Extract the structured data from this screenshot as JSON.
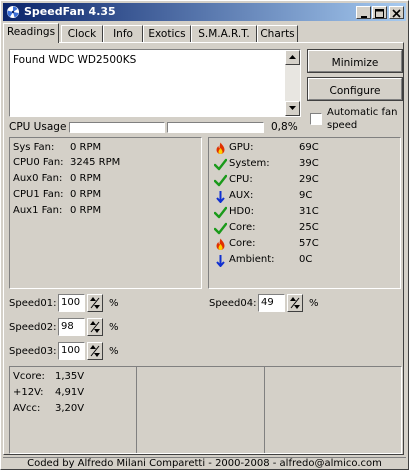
{
  "window": {
    "title": "SpeedFan 4.35",
    "controls": [
      "_",
      "□",
      "×"
    ]
  },
  "tabs": [
    "Readings",
    "Clock",
    "Info",
    "Exotics",
    "S.M.A.R.T.",
    "Charts"
  ],
  "active_tab": "Readings",
  "log": {
    "text": "Found WDC WD2500KS"
  },
  "buttons": {
    "minimize": "Minimize",
    "configure": "Configure"
  },
  "auto_fan": {
    "label_line1": "Automatic fan",
    "label_line2": "speed",
    "checked": false
  },
  "cpu_usage": {
    "label": "CPU Usage",
    "value": "0,8%",
    "bar1_fraction": 0.0,
    "bar2_fraction": 0.0
  },
  "fans": [
    {
      "label": "Sys Fan:",
      "value": "0 RPM"
    },
    {
      "label": "CPU0 Fan:",
      "value": "3245 RPM"
    },
    {
      "label": "Aux0 Fan:",
      "value": "0 RPM"
    },
    {
      "label": "CPU1 Fan:",
      "value": "0 RPM"
    },
    {
      "label": "Aux1 Fan:",
      "value": "0 RPM"
    }
  ],
  "temps": [
    {
      "label": "GPU:",
      "value": "69C",
      "icon": "flame-icon"
    },
    {
      "label": "System:",
      "value": "39C",
      "icon": "checkmark-icon"
    },
    {
      "label": "CPU:",
      "value": "29C",
      "icon": "checkmark-icon"
    },
    {
      "label": "AUX:",
      "value": "9C",
      "icon": "down-arrow-icon"
    },
    {
      "label": "HD0:",
      "value": "31C",
      "icon": "checkmark-icon"
    },
    {
      "label": "Core:",
      "value": "25C",
      "icon": "checkmark-icon"
    },
    {
      "label": "Core:",
      "value": "57C",
      "icon": "flame-icon"
    },
    {
      "label": "Ambient:",
      "value": "0C",
      "icon": "down-arrow-icon"
    }
  ],
  "speeds": [
    {
      "label": "Speed01:",
      "value": "100",
      "unit": "%"
    },
    {
      "label": "Speed02:",
      "value": "98",
      "unit": "%"
    },
    {
      "label": "Speed03:",
      "value": "100",
      "unit": "%"
    },
    {
      "label": "Speed04:",
      "value": "49",
      "unit": "%"
    }
  ],
  "voltages": [
    {
      "label": "Vcore:",
      "value": "1,35V"
    },
    {
      "label": "+12V:",
      "value": "4,91V"
    },
    {
      "label": "AVcc:",
      "value": "3,20V"
    }
  ],
  "status_bar": "Coded by Alfredo Milani Comparetti - 2000-2008 - alfredo@almico.com",
  "colors": {
    "title_start": "#0a246a",
    "title_end": "#a6caf0",
    "face": "#d4d0c8",
    "check": "#1a9a1a",
    "flame": "#e03000",
    "arrow": "#1030d0"
  }
}
